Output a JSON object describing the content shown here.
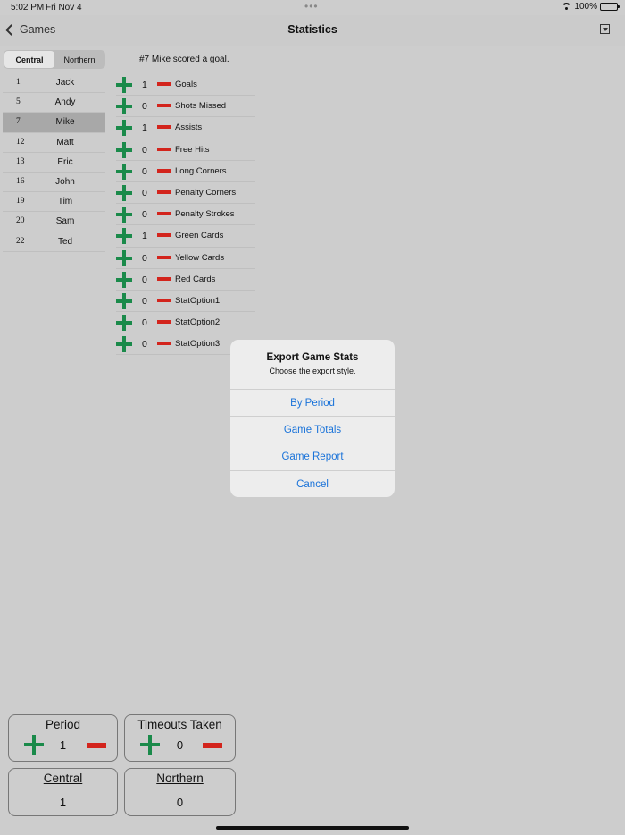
{
  "status_bar": {
    "time": "5:02 PM",
    "date": "Fri Nov 4",
    "battery": "100%"
  },
  "nav": {
    "back_label": "Games",
    "title": "Statistics"
  },
  "team_toggle": {
    "options": [
      "Central",
      "Northern"
    ],
    "selected": "Central"
  },
  "players": [
    {
      "number": "1",
      "name": "Jack"
    },
    {
      "number": "5",
      "name": "Andy"
    },
    {
      "number": "7",
      "name": "Mike",
      "selected": true
    },
    {
      "number": "12",
      "name": "Matt"
    },
    {
      "number": "13",
      "name": "Eric"
    },
    {
      "number": "16",
      "name": "John"
    },
    {
      "number": "19",
      "name": "Tim"
    },
    {
      "number": "20",
      "name": "Sam"
    },
    {
      "number": "22",
      "name": "Ted"
    }
  ],
  "last_action_message": "#7 Mike scored a goal.",
  "stats": [
    {
      "value": "1",
      "label": "Goals"
    },
    {
      "value": "0",
      "label": "Shots Missed"
    },
    {
      "value": "1",
      "label": "Assists"
    },
    {
      "value": "0",
      "label": "Free Hits"
    },
    {
      "value": "0",
      "label": "Long Corners"
    },
    {
      "value": "0",
      "label": "Penalty Corners"
    },
    {
      "value": "0",
      "label": "Penalty Strokes"
    },
    {
      "value": "1",
      "label": "Green Cards"
    },
    {
      "value": "0",
      "label": "Yellow Cards"
    },
    {
      "value": "0",
      "label": "Red Cards"
    },
    {
      "value": "0",
      "label": "StatOption1"
    },
    {
      "value": "0",
      "label": "StatOption2"
    },
    {
      "value": "0",
      "label": "StatOption3"
    }
  ],
  "dialog": {
    "title": "Export Game Stats",
    "message": "Choose the export style.",
    "buttons": [
      "By Period",
      "Game Totals",
      "Game Report",
      "Cancel"
    ]
  },
  "game_boxes": {
    "period": {
      "label": "Period",
      "value": "1"
    },
    "timeouts": {
      "label": "Timeouts Taken",
      "value": "0"
    },
    "home_score": {
      "label": "Central",
      "value": "1"
    },
    "away_score": {
      "label": "Northern",
      "value": "0"
    }
  },
  "colors": {
    "plus": "#1a8a4a",
    "minus": "#d3241c",
    "link": "#1a73d9"
  }
}
